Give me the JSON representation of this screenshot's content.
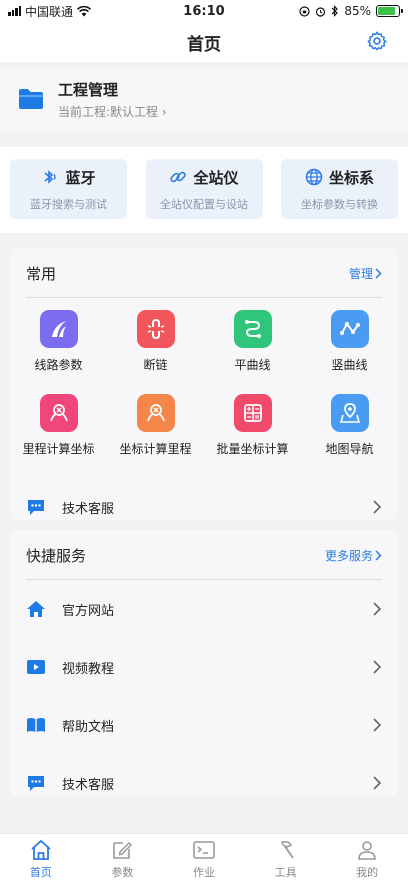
{
  "status": {
    "carrier": "中国联通",
    "time": "16:10",
    "battery": "85%",
    "battery_level": 0.85
  },
  "nav": {
    "title": "首页"
  },
  "project": {
    "title": "工程管理",
    "subtitle": "当前工程:默认工程"
  },
  "tiles": [
    {
      "label": "蓝牙",
      "desc": "蓝牙搜索与测试",
      "icon": "bluetooth-icon"
    },
    {
      "label": "全站仪",
      "desc": "全站仪配置与设站",
      "icon": "link-icon"
    },
    {
      "label": "坐标系",
      "desc": "坐标参数与转换",
      "icon": "globe-icon"
    }
  ],
  "common": {
    "title": "常用",
    "manage": "管理",
    "items": [
      {
        "label": "线路参数",
        "color": "#7b6cf0",
        "icon": "route-icon"
      },
      {
        "label": "断链",
        "color": "#f2555a",
        "icon": "broken-chain-icon"
      },
      {
        "label": "平曲线",
        "color": "#2fc57a",
        "icon": "curve-icon"
      },
      {
        "label": "竖曲线",
        "color": "#4a9cf3",
        "icon": "vertical-curve-icon"
      },
      {
        "label": "里程计算坐标",
        "color": "#f0467a",
        "icon": "compass-icon"
      },
      {
        "label": "坐标计算里程",
        "color": "#f5864a",
        "icon": "compass-icon"
      },
      {
        "label": "批量坐标计算",
        "color": "#f24a6a",
        "icon": "calculator-icon"
      },
      {
        "label": "地图导航",
        "color": "#4a9cf3",
        "icon": "map-icon"
      }
    ],
    "support": "技术客服"
  },
  "services": {
    "title": "快捷服务",
    "more": "更多服务",
    "items": [
      {
        "label": "官方网站",
        "icon": "home-icon"
      },
      {
        "label": "视频教程",
        "icon": "video-icon"
      },
      {
        "label": "帮助文档",
        "icon": "book-icon"
      },
      {
        "label": "技术客服",
        "icon": "chat-icon"
      }
    ]
  },
  "tabs": [
    {
      "label": "首页",
      "icon": "home-icon",
      "active": true
    },
    {
      "label": "参数",
      "icon": "edit-icon"
    },
    {
      "label": "作业",
      "icon": "terminal-icon"
    },
    {
      "label": "工具",
      "icon": "hammer-icon"
    },
    {
      "label": "我的",
      "icon": "user-icon"
    }
  ],
  "colors": {
    "accent": "#2d7be5",
    "tile_bg": "#ebf1fb"
  }
}
